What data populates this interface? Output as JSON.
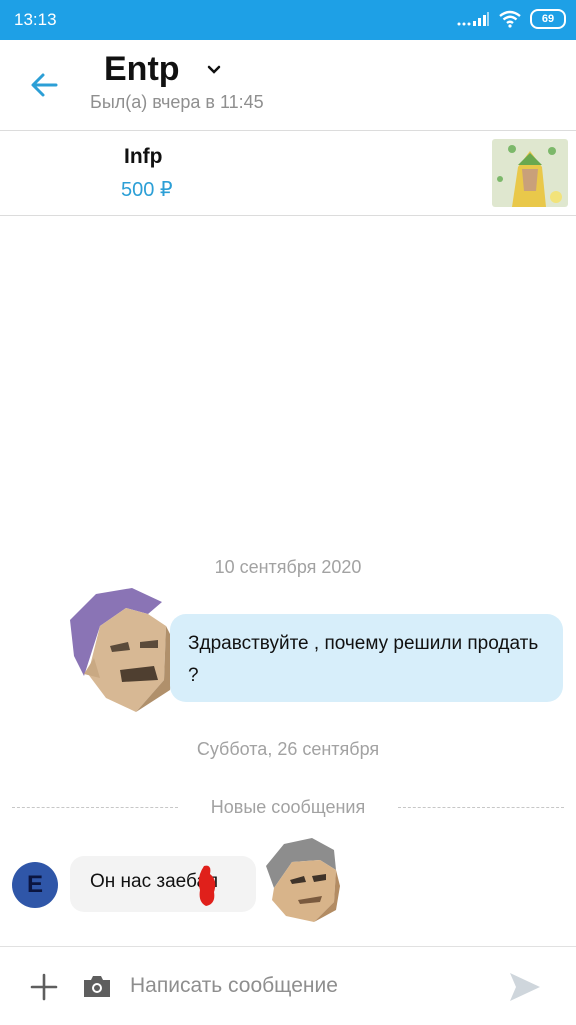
{
  "status_bar": {
    "time": "13:13",
    "battery": "69"
  },
  "header": {
    "title": "Entp",
    "subtitle": "Был(а) вчера в 11:45"
  },
  "listing": {
    "title": "Infp",
    "price": "500 ₽"
  },
  "chat": {
    "date1": "10 сентября 2020",
    "message1": "Здравствуйте , почему решили продать ?",
    "date2": "Суббота, 26 сентября",
    "new_messages_label": "Новые сообщения",
    "message2": "Он нас заебал",
    "sender_initial": "E"
  },
  "composer": {
    "placeholder": "Написать сообщение"
  },
  "colors": {
    "status_bar": "#1ea0e6",
    "accent": "#2c9fd6",
    "incoming_bubble": "#d7eefa",
    "outgoing_bubble": "#f3f3f3",
    "avatar": "#2f56a8"
  },
  "icons": [
    "back-arrow-icon",
    "chevron-down-icon",
    "wifi-icon",
    "signal-icon",
    "battery-icon",
    "plus-icon",
    "camera-icon",
    "send-icon"
  ]
}
